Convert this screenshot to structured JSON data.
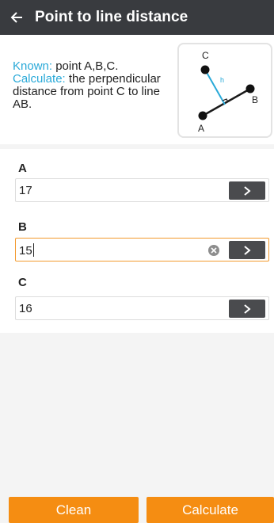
{
  "header": {
    "title": "Point to line distance",
    "back_icon": "arrow-left-icon"
  },
  "info": {
    "known_label": "Known:",
    "known_text": " point A,B,C.",
    "calc_label": "Calculate:",
    "calc_text": " the perpendicular distance from point C to line AB.",
    "diagram_labels": {
      "c": "C",
      "h": "h",
      "b": "B",
      "a": "A"
    }
  },
  "fields": [
    {
      "label": "A",
      "value": "17",
      "active": false
    },
    {
      "label": "B",
      "value": "15",
      "active": true
    },
    {
      "label": "C",
      "value": "16",
      "active": false
    }
  ],
  "buttons": {
    "clean": "Clean",
    "calculate": "Calculate"
  },
  "colors": {
    "accent": "#f58d12",
    "highlight": "#29a9d8",
    "header": "#393b3f"
  }
}
